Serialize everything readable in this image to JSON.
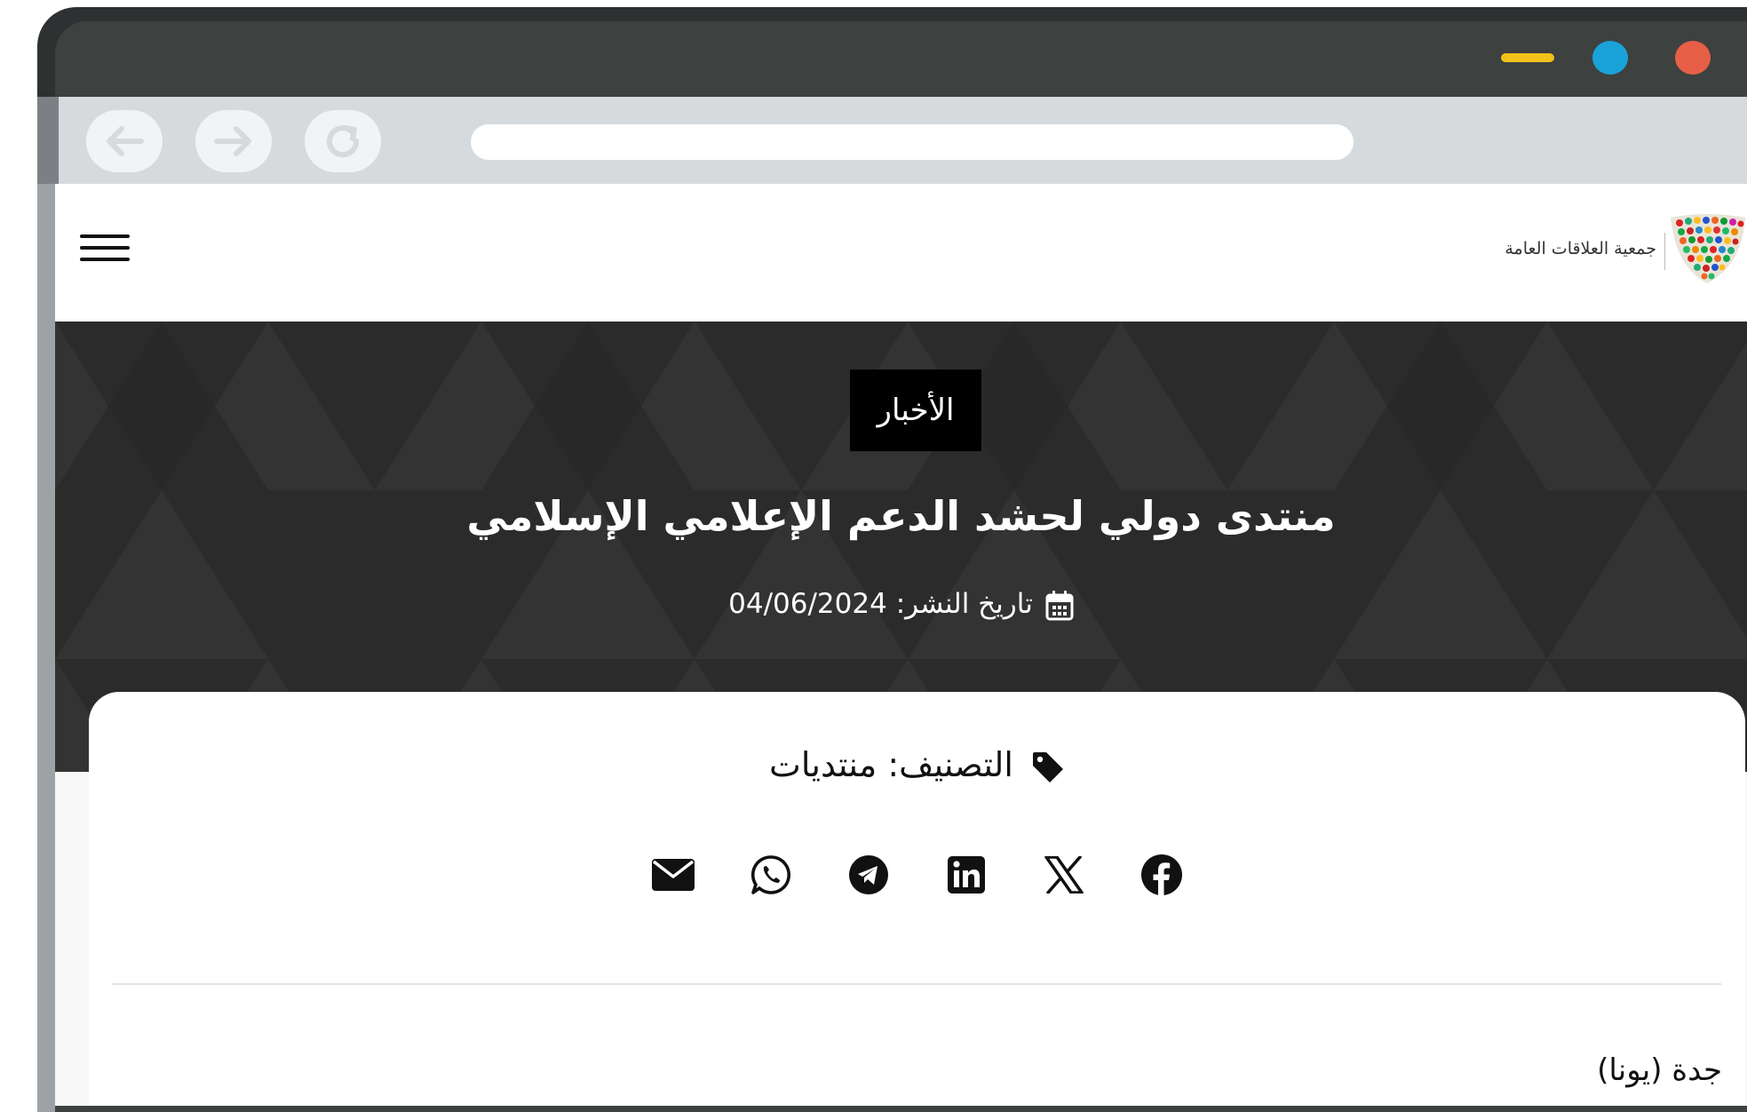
{
  "colors": {
    "window_close": "#e75f47",
    "window_maximize": "#1aa3d9",
    "window_minimize": "#f3c11b",
    "hero_bg": "#2b2b2b",
    "badge_bg": "#000000"
  },
  "browser": {
    "back_icon": "arrow-left-icon",
    "forward_icon": "arrow-right-icon",
    "reload_icon": "reload-icon"
  },
  "header": {
    "menu_icon": "hamburger-icon",
    "logo_text": "جمعية العلاقات العامة"
  },
  "hero": {
    "section_badge": "الأخبار",
    "title": "منتدى دولي لحشد الدعم الإعلامي الإسلامي",
    "date_label": "تاريخ النشر:",
    "date_value": "04/06/2024"
  },
  "article": {
    "category_label": "التصنيف:",
    "category_value": "منتديات",
    "share_icons": [
      "email-icon",
      "whatsapp-icon",
      "telegram-icon",
      "linkedin-icon",
      "x-icon",
      "facebook-icon"
    ],
    "dateline": "جدة (يونا)"
  }
}
